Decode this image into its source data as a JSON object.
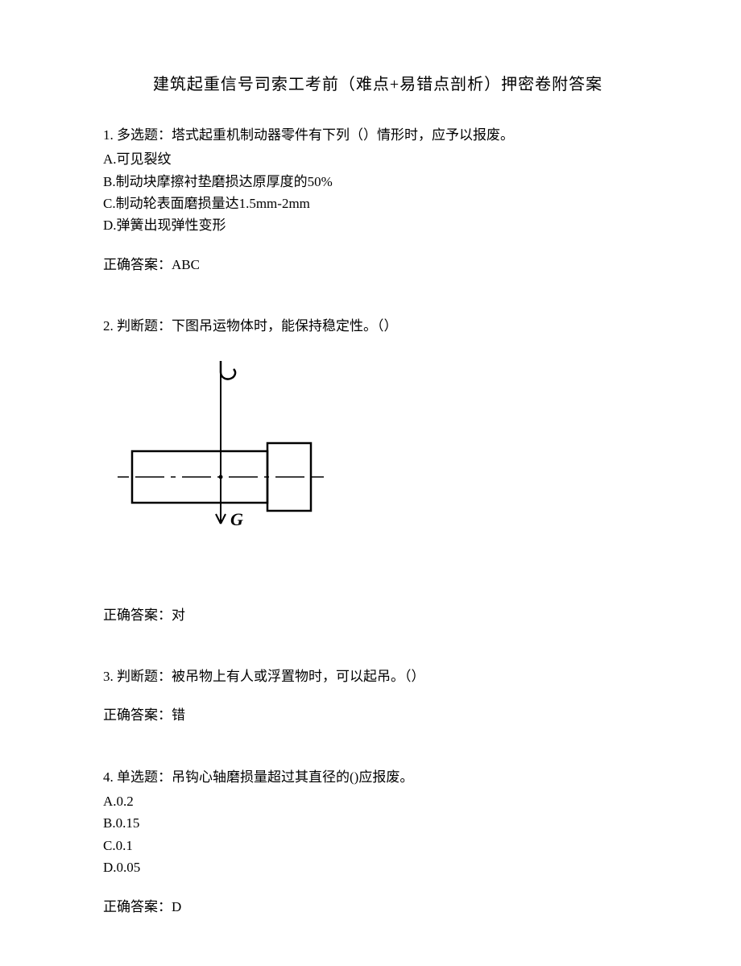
{
  "title": "建筑起重信号司索工考前（难点+易错点剖析）押密卷附答案",
  "q1": {
    "stem": "1. 多选题：塔式起重机制动器零件有下列（）情形时，应予以报废。",
    "a": "A.可见裂纹",
    "b": "B.制动块摩擦衬垫磨损达原厚度的50%",
    "c": "C.制动轮表面磨损量达1.5mm-2mm",
    "d": "D.弹簧出现弹性变形",
    "answer": "正确答案：ABC"
  },
  "q2": {
    "stem": "2. 判断题：下图吊运物体时，能保持稳定性。（）",
    "label_G": "G",
    "answer": "正确答案：对"
  },
  "q3": {
    "stem": "3. 判断题：被吊物上有人或浮置物时，可以起吊。（）",
    "answer": "正确答案：错"
  },
  "q4": {
    "stem": "4. 单选题：吊钩心轴磨损量超过其直径的()应报废。",
    "a": "A.0.2",
    "b": "B.0.15",
    "c": "C.0.1",
    "d": "D.0.05",
    "answer": "正确答案：D"
  }
}
